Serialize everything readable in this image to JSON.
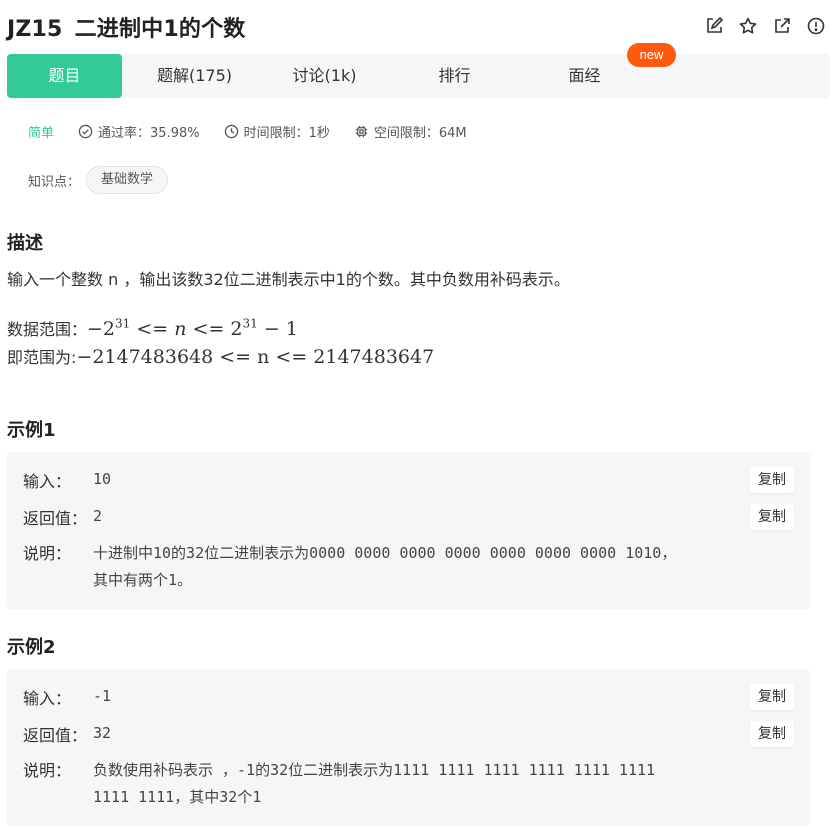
{
  "header": {
    "code": "JZ15",
    "title": "二进制中1的个数"
  },
  "tabs": [
    {
      "label": "题目",
      "active": true
    },
    {
      "label": "题解(175)",
      "active": false
    },
    {
      "label": "讨论(1k)",
      "active": false
    },
    {
      "label": "排行",
      "active": false
    },
    {
      "label": "面经",
      "active": false
    }
  ],
  "new_badge": "new",
  "meta": {
    "difficulty": "简单",
    "pass_rate": "通过率：35.98%",
    "time_limit": "时间限制：1秒",
    "space_limit": "空间限制：64M"
  },
  "knowledge": {
    "label": "知识点：",
    "tags": [
      "基础数学"
    ]
  },
  "description": {
    "heading": "描述",
    "text": "输入一个整数 n ，输出该数32位二进制表示中1的个数。其中负数用补码表示。",
    "range_label": "数据范围：",
    "range_label2": "即范围为:",
    "range2": "−2147483648 <= n <= 2147483647"
  },
  "examples": [
    {
      "heading": "示例1",
      "input_label": "输入：",
      "input": "10",
      "output_label": "返回值：",
      "output": "2",
      "note_label": "说明：",
      "note_line1": "十进制中10的32位二进制表示为0000 0000 0000 0000 0000 0000 0000 1010，",
      "note_line2": "其中有两个1。"
    },
    {
      "heading": "示例2",
      "input_label": "输入：",
      "input": "-1",
      "output_label": "返回值：",
      "output": "32",
      "note_label": "说明：",
      "note_line1": "负数使用补码表示 ，-1的32位二进制表示为1111 1111 1111 1111 1111 1111",
      "note_line2": "1111 1111，其中32个1"
    }
  ],
  "copy_label": "复制",
  "colors": {
    "accent": "#32ca99",
    "badge": "#ff5a10",
    "panel": "#f5f6f8"
  }
}
